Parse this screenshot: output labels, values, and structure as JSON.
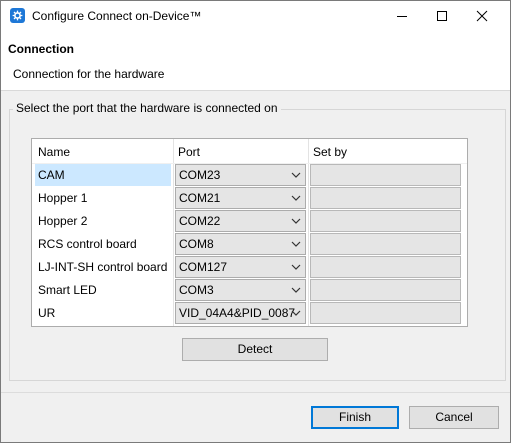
{
  "window": {
    "title": "Configure Connect on-Device™"
  },
  "header": {
    "title": "Connection",
    "description": "Connection for the hardware"
  },
  "group": {
    "label": "Select the port that the hardware is connected on"
  },
  "table": {
    "columns": [
      "Name",
      "Port",
      "Set by"
    ],
    "rows": [
      {
        "name": "CAM",
        "port": "COM23",
        "set_by": ""
      },
      {
        "name": "Hopper 1",
        "port": "COM21",
        "set_by": ""
      },
      {
        "name": "Hopper 2",
        "port": "COM22",
        "set_by": ""
      },
      {
        "name": "RCS control board",
        "port": "COM8",
        "set_by": ""
      },
      {
        "name": "LJ-INT-SH control board",
        "port": "COM127",
        "set_by": ""
      },
      {
        "name": "Smart LED",
        "port": "COM3",
        "set_by": ""
      },
      {
        "name": "UR",
        "port": "VID_04A4&PID_0087",
        "set_by": ""
      }
    ],
    "selected_row": "CAM"
  },
  "buttons": {
    "detect": "Detect",
    "finish": "Finish",
    "cancel": "Cancel"
  },
  "colors": {
    "selection": "#cce8ff",
    "default_button_border": "#0078d7",
    "app_icon": "#1e78d7"
  },
  "icons": {
    "app": "gear-icon",
    "minimize": "minimize-icon",
    "maximize": "maximize-icon",
    "close": "close-icon",
    "dropdown": "chevron-down-icon"
  }
}
